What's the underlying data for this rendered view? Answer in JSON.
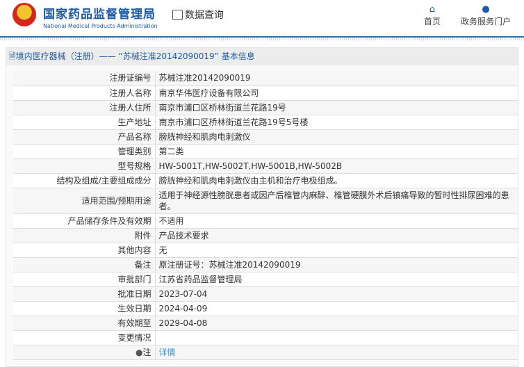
{
  "header": {
    "brand_cn": "国家药品监督管理局",
    "brand_en": "National Medical Products Administration",
    "query": "数据查询",
    "nav": [
      {
        "label": "首页",
        "icon": "home-icon"
      },
      {
        "label": "政务服务门户",
        "icon": "user-icon"
      }
    ]
  },
  "title": "境内医疗器械（注册）—— “苏械注准20142090019” 基本信息",
  "rows": [
    {
      "label": "注册证编号",
      "value": "苏械注准20142090019"
    },
    {
      "label": "注册人名称",
      "value": "南京华伟医疗设备有限公司"
    },
    {
      "label": "注册人住所",
      "value": "南京市浦口区桥林街道兰花路19号"
    },
    {
      "label": "生产地址",
      "value": "南京市浦口区桥林街道兰花路19号5号楼"
    },
    {
      "label": "产品名称",
      "value": "膀胱神经和肌肉电刺激仪"
    },
    {
      "label": "管理类别",
      "value": "第二类"
    },
    {
      "label": "型号规格",
      "value": "HW-5001T,HW-5002T,HW-5001B,HW-5002B"
    },
    {
      "label": "结构及组成/主要组成成分",
      "value": "膀胱神经和肌肉电刺激仪由主机和治疗电极组成。"
    },
    {
      "label": "适用范围/预期用途",
      "value": "适用于神经源性膀胱患者或因产后椎管内麻醉、椎管硬膜外术后镇痛导致的暂时性排尿困难的患者。"
    },
    {
      "label": "产品储存条件及有效期",
      "value": "不适用"
    },
    {
      "label": "附件",
      "value": "产品技术要求"
    },
    {
      "label": "其他内容",
      "value": "无"
    },
    {
      "label": "备注",
      "value": "原注册证号：苏械注准20142090019"
    },
    {
      "label": "审批部门",
      "value": "江苏省药品监督管理局"
    },
    {
      "label": "批准日期",
      "value": "2023-07-04"
    },
    {
      "label": "生效日期",
      "value": "2024-04-09"
    },
    {
      "label": "有效期至",
      "value": "2029-04-08"
    },
    {
      "label": "变更情况",
      "value": ""
    }
  ],
  "note": {
    "label": "注",
    "link": "详情"
  }
}
